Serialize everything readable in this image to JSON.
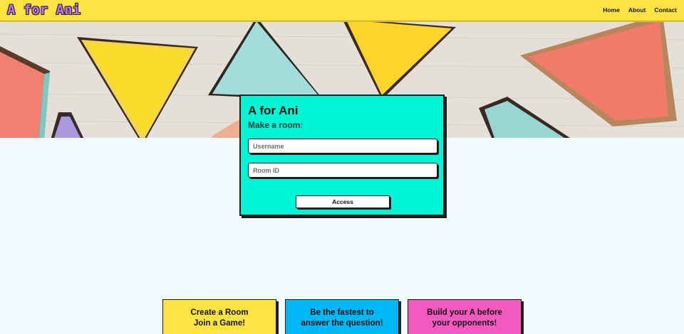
{
  "nav": {
    "logo": "A for Ani",
    "links": [
      "Home",
      "About",
      "Contact"
    ]
  },
  "form": {
    "title": "A for Ani",
    "subtitle": "Make a room:",
    "username_placeholder": "Username",
    "roomid_placeholder": "Room ID",
    "access_label": "Access"
  },
  "features": [
    {
      "text": "Create a Room\nJoin a Game!",
      "color": "#ffe342"
    },
    {
      "text": "Be the fastest to\nanswer the question!",
      "color": "#00b6f5"
    },
    {
      "text": "Build your A before\nyour opponents!",
      "color": "#f25ac0"
    }
  ],
  "colors": {
    "navbar": "#ffe342",
    "card": "#00f5d4",
    "page_bg": "#effbff"
  },
  "hero": {
    "image": "colorful wooden triangle game pieces on light wood table"
  }
}
